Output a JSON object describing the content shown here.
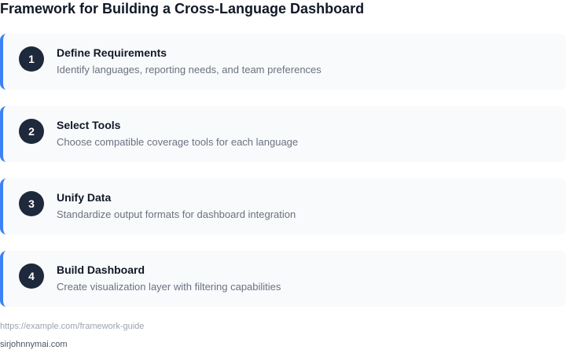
{
  "title": "Framework for Building a Cross-Language Dashboard",
  "steps": [
    {
      "number": "1",
      "title": "Define Requirements",
      "description": "Identify languages, reporting needs, and team preferences"
    },
    {
      "number": "2",
      "title": "Select Tools",
      "description": "Choose compatible coverage tools for each language"
    },
    {
      "number": "3",
      "title": "Unify Data",
      "description": "Standardize output formats for dashboard integration"
    },
    {
      "number": "4",
      "title": "Build Dashboard",
      "description": "Create visualization layer with filtering capabilities"
    }
  ],
  "footer": {
    "url": "https://example.com/framework-guide",
    "attribution": "sirjohnnymai.com"
  },
  "colors": {
    "accent": "#3b82f6",
    "badge": "#1e293b",
    "card_background": "#f8fafc"
  }
}
